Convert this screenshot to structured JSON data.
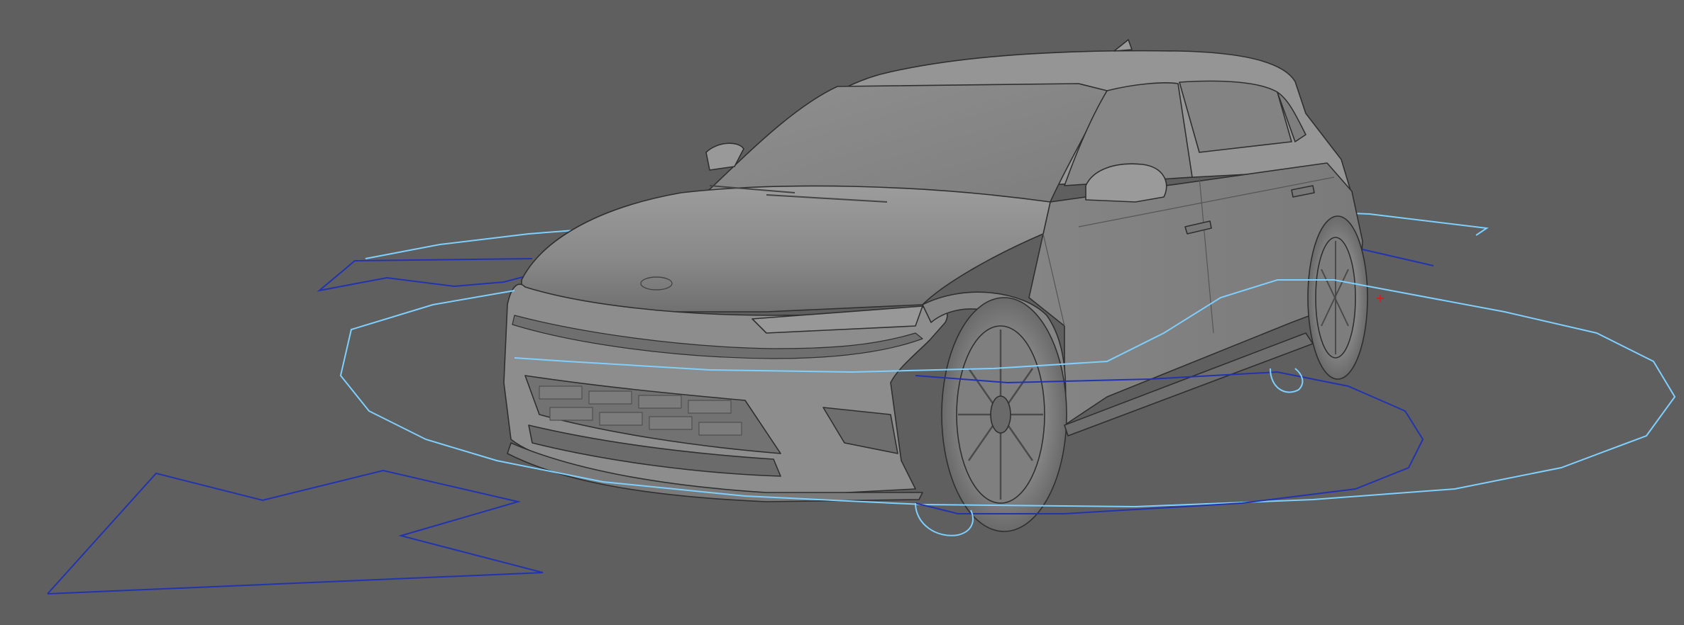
{
  "viewport": {
    "background_color": "#5f5f5f",
    "model_color": "#8c8c8c",
    "model_edge_color": "#2f2f2f",
    "control_curve_selected_color": "#7fd0ff",
    "control_curve_color": "#2233b0",
    "pivot_color": "#d0201f"
  },
  "scene": {
    "object": "car-model",
    "controls": [
      "root-move-arrow-control",
      "body-ring-control",
      "wheel-ring-control",
      "wheel-rotate-controls"
    ],
    "pivot_icon": "pivot-cross-icon"
  }
}
